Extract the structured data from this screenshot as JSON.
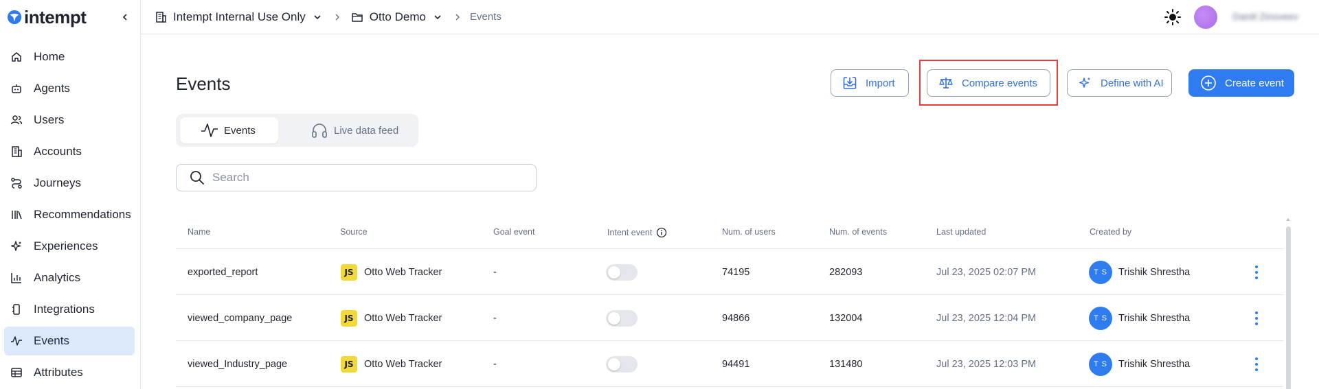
{
  "brand": {
    "name": "intempt",
    "accent": "#2f7cf0"
  },
  "sidebar": {
    "items": [
      {
        "label": "Home",
        "icon": "home-icon",
        "active": false
      },
      {
        "label": "Agents",
        "icon": "robot-icon",
        "active": false
      },
      {
        "label": "Users",
        "icon": "users-icon",
        "active": false
      },
      {
        "label": "Accounts",
        "icon": "building-icon",
        "active": false
      },
      {
        "label": "Journeys",
        "icon": "route-icon",
        "active": false
      },
      {
        "label": "Recommendations",
        "icon": "library-icon",
        "active": false
      },
      {
        "label": "Experiences",
        "icon": "sparkle-icon",
        "active": false
      },
      {
        "label": "Analytics",
        "icon": "chart-icon",
        "active": false
      },
      {
        "label": "Integrations",
        "icon": "plug-icon",
        "active": false
      },
      {
        "label": "Events",
        "icon": "pulse-icon",
        "active": true
      },
      {
        "label": "Attributes",
        "icon": "table-icon",
        "active": false
      }
    ]
  },
  "topbar": {
    "org": "Intempt Internal Use Only",
    "project": "Otto Demo",
    "current": "Events",
    "user_name": "Daniil Zinoveev"
  },
  "main": {
    "title": "Events",
    "buttons": {
      "import": "Import",
      "compare": "Compare events",
      "define": "Define with AI",
      "create": "Create event"
    },
    "tabs": [
      {
        "label": "Events",
        "active": true
      },
      {
        "label": "Live data feed",
        "active": false
      }
    ],
    "search": {
      "placeholder": "Search",
      "value": ""
    }
  },
  "table": {
    "columns": [
      "Name",
      "Source",
      "Goal event",
      "Intent event",
      "Num. of users",
      "Num. of events",
      "Last updated",
      "Created by"
    ],
    "rows": [
      {
        "name": "exported_report",
        "source": "Otto Web Tracker",
        "source_badge": "JS",
        "goal": "-",
        "intent": false,
        "users": "74195",
        "events": "282093",
        "updated": "Jul 23, 2025 02:07 PM",
        "initials": "T S",
        "creator": "Trishik Shrestha"
      },
      {
        "name": "viewed_company_page",
        "source": "Otto Web Tracker",
        "source_badge": "JS",
        "goal": "-",
        "intent": false,
        "users": "94866",
        "events": "132004",
        "updated": "Jul 23, 2025 12:04 PM",
        "initials": "T S",
        "creator": "Trishik Shrestha"
      },
      {
        "name": "viewed_Industry_page",
        "source": "Otto Web Tracker",
        "source_badge": "JS",
        "goal": "-",
        "intent": false,
        "users": "94491",
        "events": "131480",
        "updated": "Jul 23, 2025 12:03 PM",
        "initials": "T S",
        "creator": "Trishik Shrestha"
      }
    ]
  }
}
